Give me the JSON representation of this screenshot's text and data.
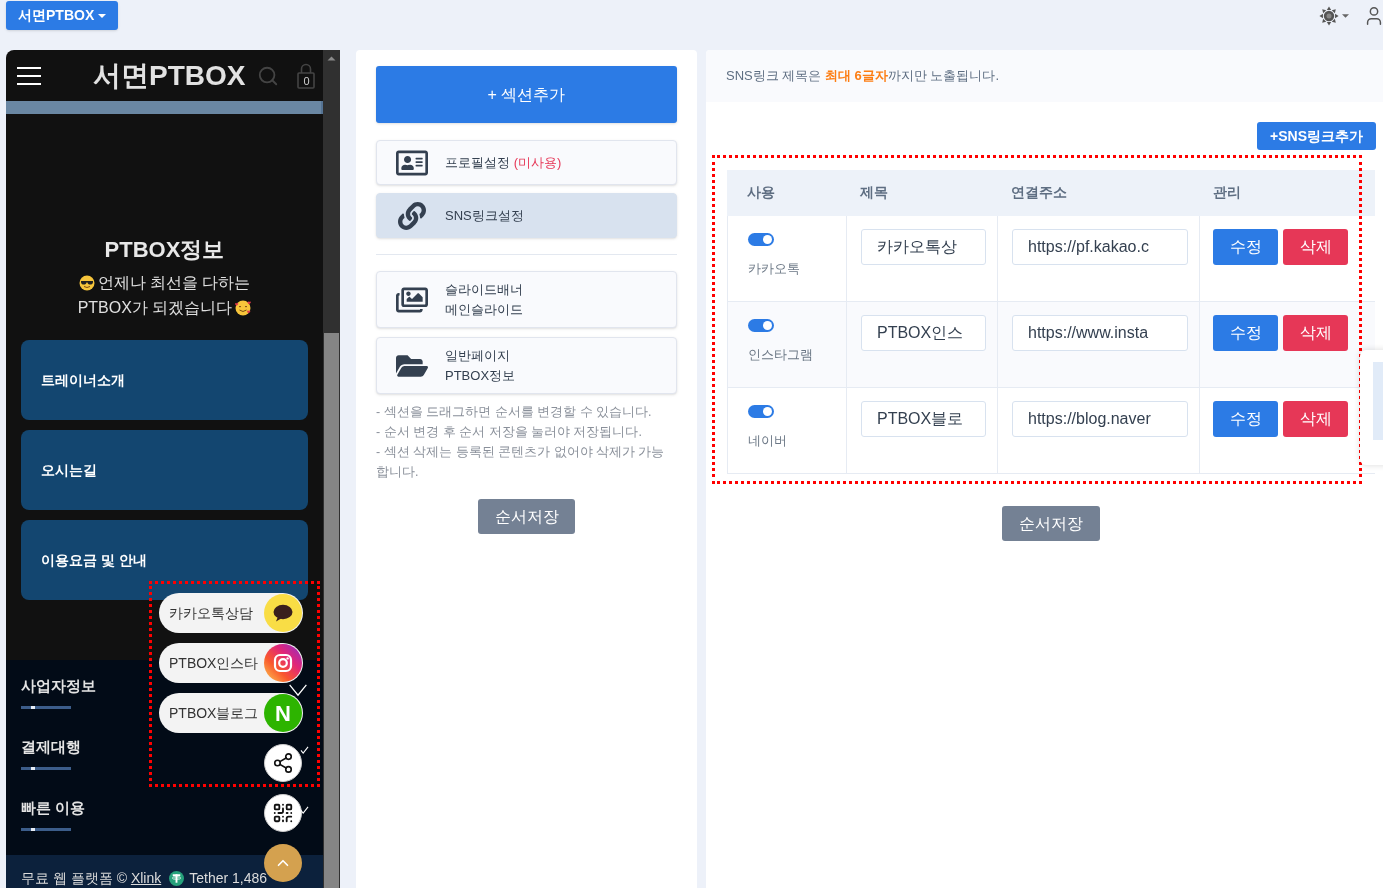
{
  "top_bar": {
    "site_button": "서면PTBOX"
  },
  "preview": {
    "title": "서면PTBOX",
    "cart_count": "0",
    "intro_title": "PTBOX정보",
    "intro_lines": [
      "언제나 최선을 다하는",
      "PTBOX가 되겠습니다"
    ],
    "menu_cards": [
      "트레이너소개",
      "오시는길",
      "이용요금 및 안내"
    ],
    "footer_sections": [
      "사업자정보",
      "결제대행",
      "빠른 이용"
    ],
    "copyright": "무료 웹 플랫폼 ©",
    "copyright_link": "Xlink",
    "ticker": "Tether 1,486",
    "floating_links": [
      {
        "kind": "kakao",
        "label": "카카오톡상담"
      },
      {
        "kind": "instagram",
        "label": "PTBOX인스타"
      },
      {
        "kind": "blog",
        "label": "PTBOX블로그",
        "badge": "N"
      }
    ]
  },
  "sections_panel": {
    "add_button": "+ 섹션추가",
    "groups": [
      {
        "items": [
          {
            "kind": "profile",
            "title": "프로필설정",
            "note": "(미사용)",
            "selected": false
          },
          {
            "kind": "link",
            "title": "SNS링크설정",
            "selected": true
          }
        ]
      },
      {
        "items": [
          {
            "kind": "slides",
            "title": "슬라이드배너",
            "subtitle": "메인슬라이드",
            "selected": false
          },
          {
            "kind": "page",
            "title": "일반페이지",
            "subtitle": "PTBOX정보",
            "selected": false
          }
        ]
      }
    ],
    "notes": [
      "- 섹션을 드래그하면 순서를 변경할 수 있습니다.",
      "- 순서 변경 후 순서 저장을 눌러야 저장됩니다.",
      "- 섹션 삭제는 등록된 콘텐츠가 없어야 삭제가 가능합니다."
    ],
    "save_button": "순서저장"
  },
  "sns_panel": {
    "notice": "SNS링크 제목은 **최대 6글자**까지만 노출됩니다.",
    "add_button": "+SNS링크추가",
    "columns": [
      "사용",
      "제목",
      "연결주소",
      "관리"
    ],
    "rows": [
      {
        "on": true,
        "label": "카카오톡",
        "title": "카카오톡상",
        "url": "https://pf.kakao.c",
        "edit": "수정",
        "delete": "삭제"
      },
      {
        "on": true,
        "label": "인스타그램",
        "title": "PTBOX인스",
        "url": "https://www.insta",
        "edit": "수정",
        "delete": "삭제"
      },
      {
        "on": true,
        "label": "네이버",
        "title": "PTBOX블로",
        "url": "https://blog.naver",
        "edit": "수정",
        "delete": "삭제"
      }
    ],
    "save_button": "순서저장"
  }
}
